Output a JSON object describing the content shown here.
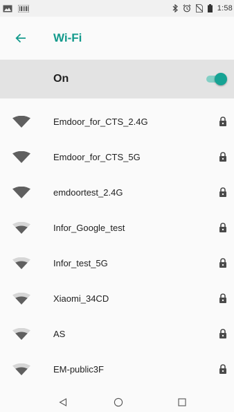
{
  "status_bar": {
    "time": "1:58",
    "left_icons": [
      "image-icon",
      "barcode-icon"
    ],
    "right_icons": [
      "bluetooth-icon",
      "alarm-icon",
      "no-sim-icon",
      "battery-icon"
    ]
  },
  "app_bar": {
    "back_icon": "arrow-back-icon",
    "title": "Wi-Fi",
    "accent_color": "#139a8c"
  },
  "master_switch": {
    "label": "On",
    "state": true
  },
  "networks": [
    {
      "name": "Emdoor_for_CTS_2.4G",
      "signal": "strong",
      "secured": true
    },
    {
      "name": "Emdoor_for_CTS_5G",
      "signal": "strong",
      "secured": true
    },
    {
      "name": "emdoortest_2.4G",
      "signal": "strong",
      "secured": true
    },
    {
      "name": "Infor_Google_test",
      "signal": "medium",
      "secured": true
    },
    {
      "name": "Infor_test_5G",
      "signal": "medium",
      "secured": true
    },
    {
      "name": "Xiaomi_34CD",
      "signal": "medium",
      "secured": true
    },
    {
      "name": "AS",
      "signal": "medium",
      "secured": true
    },
    {
      "name": "EM-public3F",
      "signal": "medium",
      "secured": true
    }
  ],
  "nav_bar": {
    "buttons": [
      "back-triangle-icon",
      "home-circle-icon",
      "recents-square-icon"
    ]
  }
}
